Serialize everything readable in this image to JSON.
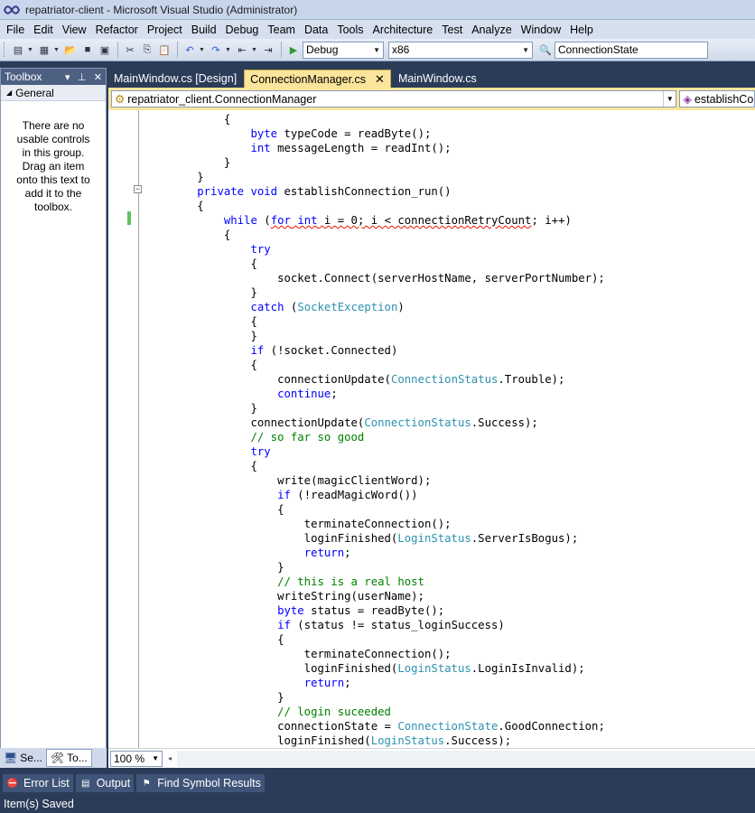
{
  "window": {
    "title": "repatriator-client - Microsoft Visual Studio (Administrator)"
  },
  "menu": [
    "File",
    "Edit",
    "View",
    "Refactor",
    "Project",
    "Build",
    "Debug",
    "Team",
    "Data",
    "Tools",
    "Architecture",
    "Test",
    "Analyze",
    "Window",
    "Help"
  ],
  "toolbar": {
    "config_value": "Debug",
    "platform_value": "x86",
    "find_value": "ConnectionState"
  },
  "toolbox": {
    "title": "Toolbox",
    "group": "General",
    "empty_message": "There are no usable controls in this group. Drag an item onto this text to add it to the toolbox.",
    "tabs": [
      "Se...",
      "To..."
    ]
  },
  "tabs": [
    {
      "label": "MainWindow.cs [Design]",
      "active": false
    },
    {
      "label": "ConnectionManager.cs",
      "active": true
    },
    {
      "label": "MainWindow.cs",
      "active": false
    }
  ],
  "navbar": {
    "type_value": "repatriator_client.ConnectionManager",
    "member_value": "establishCo"
  },
  "code_lines": [
    [
      [
        "",
        "            {"
      ]
    ],
    [
      [
        "",
        "                "
      ],
      [
        "kw",
        "byte"
      ],
      [
        "",
        " typeCode = readByte();"
      ]
    ],
    [
      [
        "",
        "                "
      ],
      [
        "kw",
        "int"
      ],
      [
        "",
        " messageLength = readInt();"
      ]
    ],
    [
      [
        "",
        "            }"
      ]
    ],
    [
      [
        "",
        "        }"
      ]
    ],
    [
      [
        "",
        "        "
      ],
      [
        "kw",
        "private"
      ],
      [
        "",
        " "
      ],
      [
        "kw",
        "void"
      ],
      [
        "",
        " establishConnection_run()"
      ]
    ],
    [
      [
        "",
        "        {"
      ]
    ],
    [
      [
        "",
        "            "
      ],
      [
        "kw",
        "while"
      ],
      [
        "",
        " ("
      ],
      [
        "kw sq",
        "for"
      ],
      [
        "sq",
        " "
      ],
      [
        "kw sq",
        "int"
      ],
      [
        "sq",
        " i = 0; i < connectionRetryCount"
      ],
      [
        "",
        "; i++)"
      ]
    ],
    [
      [
        "",
        "            {"
      ]
    ],
    [
      [
        "",
        "                "
      ],
      [
        "kw",
        "try"
      ]
    ],
    [
      [
        "",
        "                {"
      ]
    ],
    [
      [
        "",
        "                    socket.Connect(serverHostName, serverPortNumber);"
      ]
    ],
    [
      [
        "",
        "                }"
      ]
    ],
    [
      [
        "",
        "                "
      ],
      [
        "kw",
        "catch"
      ],
      [
        "",
        " ("
      ],
      [
        "ty",
        "SocketException"
      ],
      [
        "",
        ")"
      ]
    ],
    [
      [
        "",
        "                {"
      ]
    ],
    [
      [
        "",
        "                }"
      ]
    ],
    [
      [
        "",
        "                "
      ],
      [
        "kw",
        "if"
      ],
      [
        "",
        " (!socket.Connected)"
      ]
    ],
    [
      [
        "",
        "                {"
      ]
    ],
    [
      [
        "",
        "                    connectionUpdate("
      ],
      [
        "ty",
        "ConnectionStatus"
      ],
      [
        "",
        ".Trouble);"
      ]
    ],
    [
      [
        "",
        "                    "
      ],
      [
        "kw",
        "continue"
      ],
      [
        "",
        ";"
      ]
    ],
    [
      [
        "",
        "                }"
      ]
    ],
    [
      [
        "",
        "                connectionUpdate("
      ],
      [
        "ty",
        "ConnectionStatus"
      ],
      [
        "",
        ".Success);"
      ]
    ],
    [
      [
        "cm",
        "                // so far so good"
      ]
    ],
    [
      [
        "",
        "                "
      ],
      [
        "kw",
        "try"
      ]
    ],
    [
      [
        "",
        "                {"
      ]
    ],
    [
      [
        "",
        "                    write(magicClientWord);"
      ]
    ],
    [
      [
        "",
        "                    "
      ],
      [
        "kw",
        "if"
      ],
      [
        "",
        " (!readMagicWord())"
      ]
    ],
    [
      [
        "",
        "                    {"
      ]
    ],
    [
      [
        "",
        "                        terminateConnection();"
      ]
    ],
    [
      [
        "",
        "                        loginFinished("
      ],
      [
        "ty",
        "LoginStatus"
      ],
      [
        "",
        ".ServerIsBogus);"
      ]
    ],
    [
      [
        "",
        "                        "
      ],
      [
        "kw",
        "return"
      ],
      [
        "",
        ";"
      ]
    ],
    [
      [
        "",
        "                    }"
      ]
    ],
    [
      [
        "cm",
        "                    // this is a real host"
      ]
    ],
    [
      [
        "",
        "                    writeString(userName);"
      ]
    ],
    [
      [
        "",
        "                    "
      ],
      [
        "kw",
        "byte"
      ],
      [
        "",
        " status = readByte();"
      ]
    ],
    [
      [
        "",
        "                    "
      ],
      [
        "kw",
        "if"
      ],
      [
        "",
        " (status != status_loginSuccess)"
      ]
    ],
    [
      [
        "",
        "                    {"
      ]
    ],
    [
      [
        "",
        "                        terminateConnection();"
      ]
    ],
    [
      [
        "",
        "                        loginFinished("
      ],
      [
        "ty",
        "LoginStatus"
      ],
      [
        "",
        ".LoginIsInvalid);"
      ]
    ],
    [
      [
        "",
        "                        "
      ],
      [
        "kw",
        "return"
      ],
      [
        "",
        ";"
      ]
    ],
    [
      [
        "",
        "                    }"
      ]
    ],
    [
      [
        "cm",
        "                    // login suceeded"
      ]
    ],
    [
      [
        "",
        "                    connectionState = "
      ],
      [
        "ty",
        "ConnectionState"
      ],
      [
        "",
        ".GoodConnection;"
      ]
    ],
    [
      [
        "",
        "                    loginFinished("
      ],
      [
        "ty",
        "LoginStatus"
      ],
      [
        "",
        ".Success);"
      ]
    ]
  ],
  "zoom": "100 %",
  "bottom_tabs": [
    "Error List",
    "Output",
    "Find Symbol Results"
  ],
  "status": "Item(s) Saved"
}
